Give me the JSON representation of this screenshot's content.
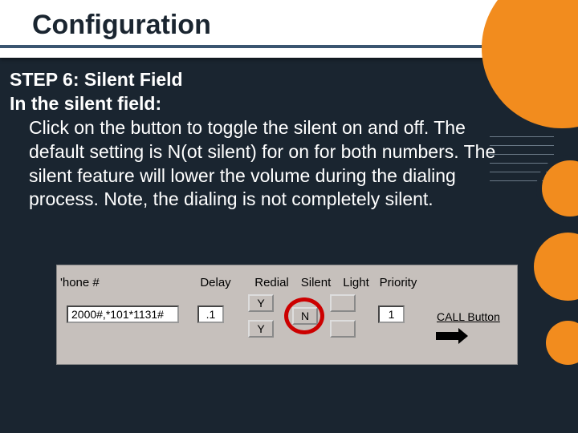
{
  "title": "Configuration",
  "step_heading": "STEP 6:  Silent Field",
  "field_label": "In the silent field:",
  "instructions": "Click on the button to toggle the silent on and off. The default setting is N(ot silent) for on for both numbers.   The silent feature will lower the volume during the dialing process.  Note, the dialing is not completely silent.",
  "ui": {
    "headers": {
      "phone": "'hone #",
      "delay": "Delay",
      "redial": "Redial",
      "silent": "Silent",
      "light": "Light",
      "priority": "Priority"
    },
    "fields": {
      "phone_value": "2000#,*101*1131#",
      "delay_value": ".1",
      "redial_top": "Y",
      "redial_bottom": "Y",
      "silent": "N",
      "light_top": "",
      "light_bottom": "",
      "priority": "1",
      "call_label": "CALL Button"
    }
  }
}
